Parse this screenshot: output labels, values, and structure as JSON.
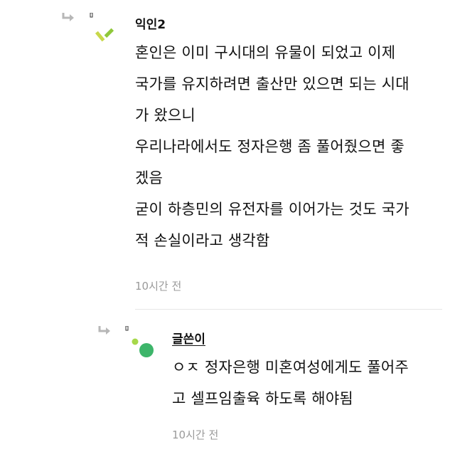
{
  "comment": {
    "nickname": "익인2",
    "lines": [
      "혼인은 이미 구시대의 유물이 되었고 이제",
      "국가를 유지하려면 출산만 있으면 되는 시대",
      "가 왔으니",
      "우리나라에서도 정자은행 좀 풀어줬으면 좋",
      "겠음",
      "굳이 하층민의 유전자를 이어가는 것도 국가",
      "적 손실이라고 생각함"
    ],
    "time": "10시간 전",
    "avatar_colors": [
      "#c8d84a",
      "#8fc83a"
    ]
  },
  "reply": {
    "nickname": "글쓴이",
    "lines": [
      "ㅇㅈ 정자은행 미혼여성에게도 풀어주",
      "고 셀프임출육 하도록 해야됨"
    ],
    "time": "10시간 전",
    "avatar_colors": [
      "#a6d84a",
      "#3db56a"
    ]
  },
  "icons": {
    "reply_arrow": "reply-arrow-icon"
  }
}
